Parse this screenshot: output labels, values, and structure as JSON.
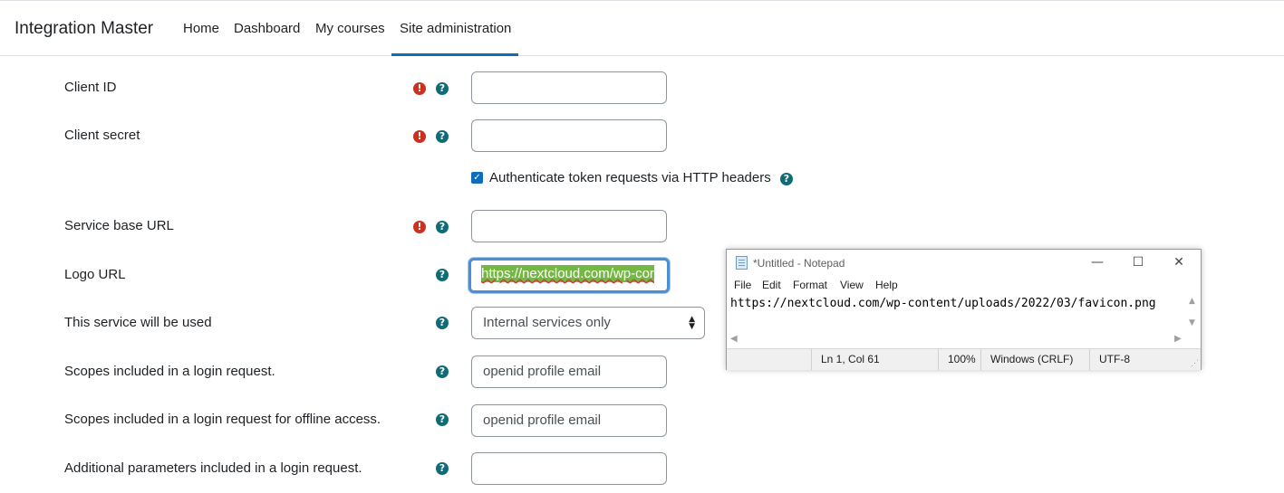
{
  "navbar": {
    "brand": "Integration Master",
    "links": [
      "Home",
      "Dashboard",
      "My courses",
      "Site administration"
    ],
    "active": "Site administration"
  },
  "form": {
    "client_id": {
      "label": "Client ID",
      "value": ""
    },
    "client_secret": {
      "label": "Client secret",
      "value": ""
    },
    "auth_header": {
      "label": "Authenticate token requests via HTTP headers",
      "checked": true
    },
    "service_base_url": {
      "label": "Service base URL",
      "value": ""
    },
    "logo_url": {
      "label": "Logo URL",
      "value": "https://nextcloud.com/wp-cor"
    },
    "service_usage": {
      "label": "This service will be used",
      "value": "Internal services only"
    },
    "scopes_login": {
      "label": "Scopes included in a login request.",
      "value": "openid profile email"
    },
    "scopes_offline": {
      "label": "Scopes included in a login request for offline access.",
      "value": "openid profile email"
    },
    "additional_params": {
      "label": "Additional parameters included in a login request.",
      "value": ""
    }
  },
  "icons": {
    "required": "!",
    "help": "?"
  },
  "notepad": {
    "title": "*Untitled - Notepad",
    "menu": [
      "File",
      "Edit",
      "Format",
      "View",
      "Help"
    ],
    "content": "https://nextcloud.com/wp-content/uploads/2022/03/favicon.png",
    "status": {
      "position": "Ln 1, Col 61",
      "zoom": "100%",
      "line_ending": "Windows (CRLF)",
      "encoding": "UTF-8"
    },
    "controls": {
      "minimize": "—",
      "maximize": "☐",
      "close": "✕"
    }
  },
  "colors": {
    "accent": "#0f6cbf",
    "required": "#ca3120",
    "help": "#0f6c76",
    "selection": "#74b843"
  }
}
